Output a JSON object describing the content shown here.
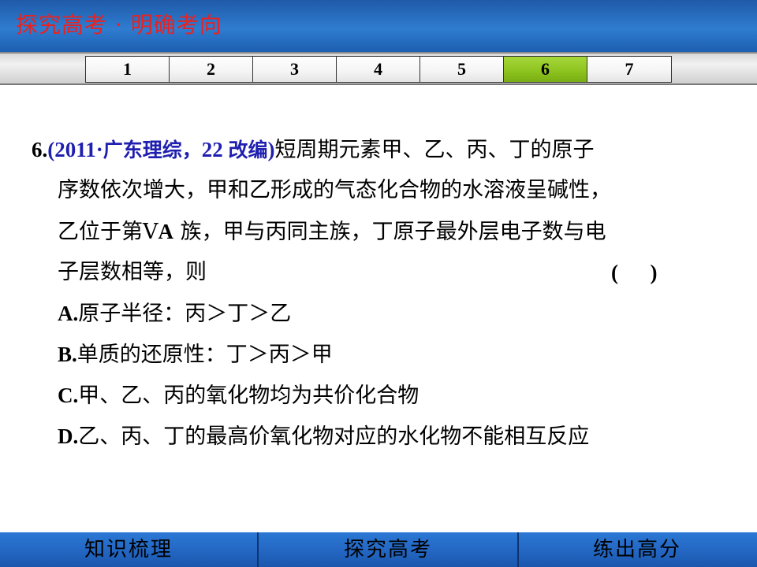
{
  "header": {
    "title": "探究高考 · 明确考向"
  },
  "tabs": [
    {
      "label": "1",
      "active": false
    },
    {
      "label": "2",
      "active": false
    },
    {
      "label": "3",
      "active": false
    },
    {
      "label": "4",
      "active": false
    },
    {
      "label": "5",
      "active": false
    },
    {
      "label": "6",
      "active": true
    },
    {
      "label": "7",
      "active": false
    }
  ],
  "question": {
    "number": "6.",
    "source_open": "(2011·",
    "source_cn": "广东理综，",
    "source_num": "22 ",
    "source_cn2": "改编",
    "source_close": ")",
    "line1_text": "短周期元素甲、乙、丙、丁的原子",
    "line2_text": "序数依次增大，甲和乙形成的气态化合物的水溶液呈碱性，",
    "line3_pre": "乙位于第Ⅴ",
    "line3_bold": "A",
    "line3_post": " 族，甲与丙同主族，丁原子最外层电子数与电",
    "line4_text": "子层数相等，则",
    "answer_paren": "(      )",
    "options": [
      {
        "label": "A.",
        "text": "原子半径：丙＞丁＞乙"
      },
      {
        "label": "B.",
        "text": "单质的还原性：丁＞丙＞甲"
      },
      {
        "label": "C.",
        "text": "甲、乙、丙的氧化物均为共价化合物"
      },
      {
        "label": "D.",
        "text": "乙、丙、丁的最高价氧化物对应的水化物不能相互反应"
      }
    ]
  },
  "footer": {
    "items": [
      "知识梳理",
      "探究高考",
      "练出高分"
    ]
  },
  "colors": {
    "header_bg": "#2f7cd0",
    "header_title": "#e82222",
    "active_tab": "#8cc21e",
    "source_text": "#1f1fb0",
    "footer_bg": "#2468c4"
  }
}
